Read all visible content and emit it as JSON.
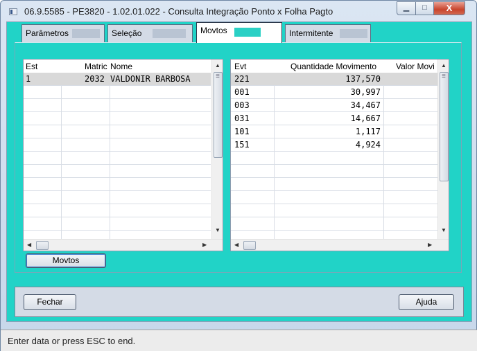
{
  "window": {
    "title": "06.9.5585 - PE3820 - 1.02.01.022 - Consulta Integração Ponto x Folha Pagto",
    "minimize_glyph": "▁",
    "maximize_glyph": "□",
    "close_glyph": "X"
  },
  "tabs": [
    {
      "label": "Parâmetros",
      "active": false
    },
    {
      "label": "Seleção",
      "active": false
    },
    {
      "label": "Movtos",
      "active": true
    },
    {
      "label": "Intermitente",
      "active": false
    }
  ],
  "left_grid": {
    "columns": [
      "Est",
      "Matric",
      "Nome"
    ],
    "rows": [
      {
        "est": "1",
        "matric": "2032",
        "nome": "VALDONIR BARBOSA"
      }
    ]
  },
  "right_grid": {
    "columns": [
      "Evt",
      "Quantidade Movimento",
      "Valor Movi"
    ],
    "rows": [
      {
        "evt": "221",
        "quantidade": "137,570",
        "valor": ""
      },
      {
        "evt": "001",
        "quantidade": "30,997",
        "valor": ""
      },
      {
        "evt": "003",
        "quantidade": "34,467",
        "valor": ""
      },
      {
        "evt": "031",
        "quantidade": "14,667",
        "valor": ""
      },
      {
        "evt": "101",
        "quantidade": "1,117",
        "valor": ""
      },
      {
        "evt": "151",
        "quantidade": "4,924",
        "valor": ""
      }
    ]
  },
  "buttons": {
    "movtos": "Movtos",
    "fechar": "Fechar",
    "ajuda": "Ajuda"
  },
  "status": {
    "text": "Enter data or press ESC to end."
  },
  "colors": {
    "client_bg": "#21d3c7",
    "selected_row": "#d9d9d9",
    "panel_bg": "#d4dbe6"
  }
}
